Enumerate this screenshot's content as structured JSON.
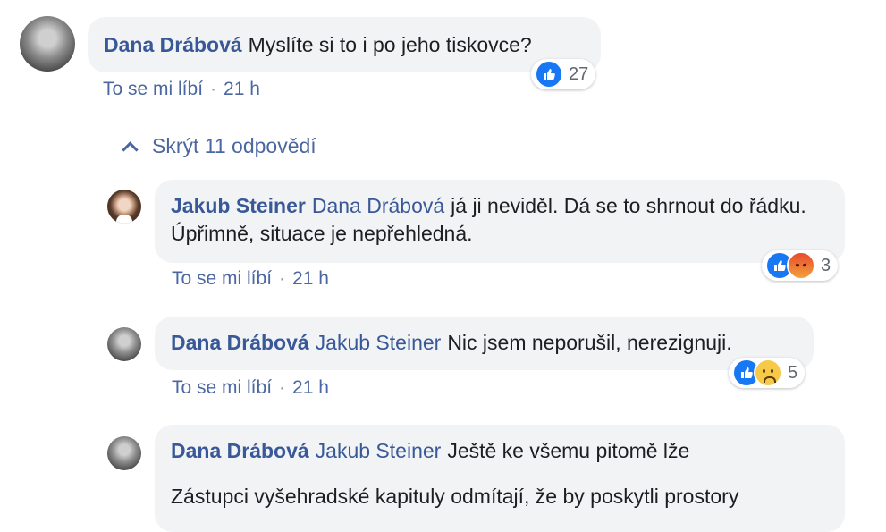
{
  "toggle_replies": {
    "label": "Skrýt 11 odpovědí"
  },
  "comments": [
    {
      "author": "Dana Drábová",
      "mention": "",
      "text": "Myslíte si to i po jeho tiskovce?",
      "like_label": "To se mi líbí",
      "separator": "·",
      "time": "21 h",
      "reaction_count": "27",
      "reactions": [
        "like-icon"
      ]
    },
    {
      "author": "Jakub Steiner",
      "mention": "Dana Drábová",
      "text": "já ji neviděl. Dá se to shrnout do řádku. Úpřimně, situace je nepřehledná.",
      "like_label": "To se mi líbí",
      "separator": "·",
      "time": "21 h",
      "reaction_count": "3",
      "reactions": [
        "like-icon",
        "angry-icon"
      ]
    },
    {
      "author": "Dana Drábová",
      "mention": "Jakub Steiner",
      "text": "Nic jsem neporušil, nerezignuji.",
      "like_label": "To se mi líbí",
      "separator": "·",
      "time": "21 h",
      "reaction_count": "5",
      "reactions": [
        "like-icon",
        "sad-icon"
      ]
    },
    {
      "author": "Dana Drábová",
      "mention": "Jakub Steiner",
      "text": "Ještě ke všemu pitomě lže",
      "text2": "Zástupci vyšehradské kapituly odmítají, že by poskytli prostory"
    }
  ]
}
